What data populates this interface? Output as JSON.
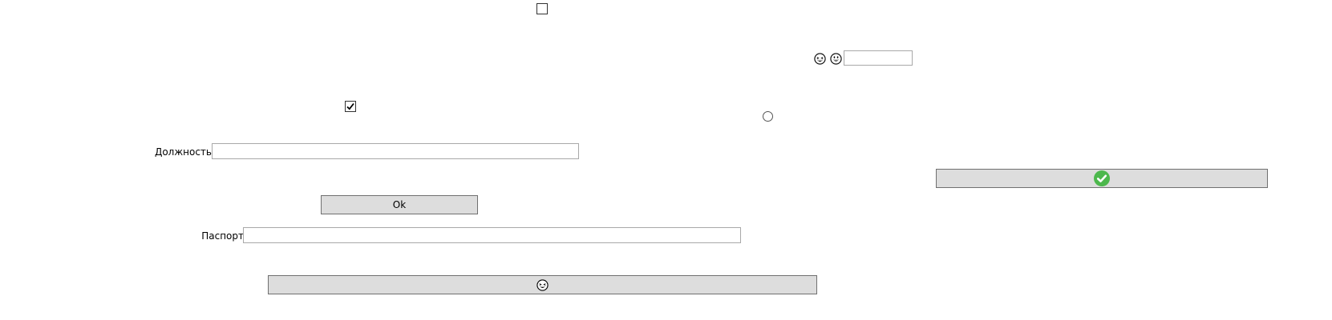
{
  "form": {
    "position_label": "Должность",
    "position_value": "",
    "passport_label": "Паспорт",
    "passport_value": "",
    "small_input_value": "",
    "ok_button_label": "Ok",
    "top_checkbox_checked": false,
    "checkbox_checked": true,
    "radio_selected": false
  },
  "icons": {
    "emoji_1": "grinning-squint-face-icon",
    "emoji_2": "grinning-face-icon",
    "confirm": "green-checkmark-icon",
    "emoji_button": "grinning-squint-face-icon"
  },
  "colors": {
    "button_bg": "#dddddd",
    "button_border": "#707070",
    "input_border": "#a8a8a8",
    "confirm_green": "#4db84d"
  }
}
